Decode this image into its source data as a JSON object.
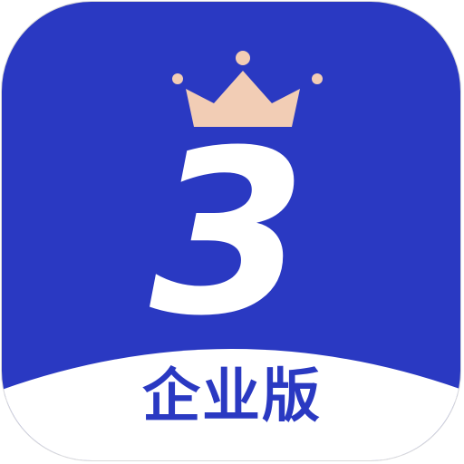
{
  "app_icon": {
    "label": "企业版",
    "numeral": "3",
    "emblem": "crown-icon",
    "colors": {
      "background": "#2a39c2",
      "crown": "#f2cdb5",
      "numeral": "#ffffff",
      "label": "#2a39c2",
      "footer": "#ffffff"
    }
  }
}
